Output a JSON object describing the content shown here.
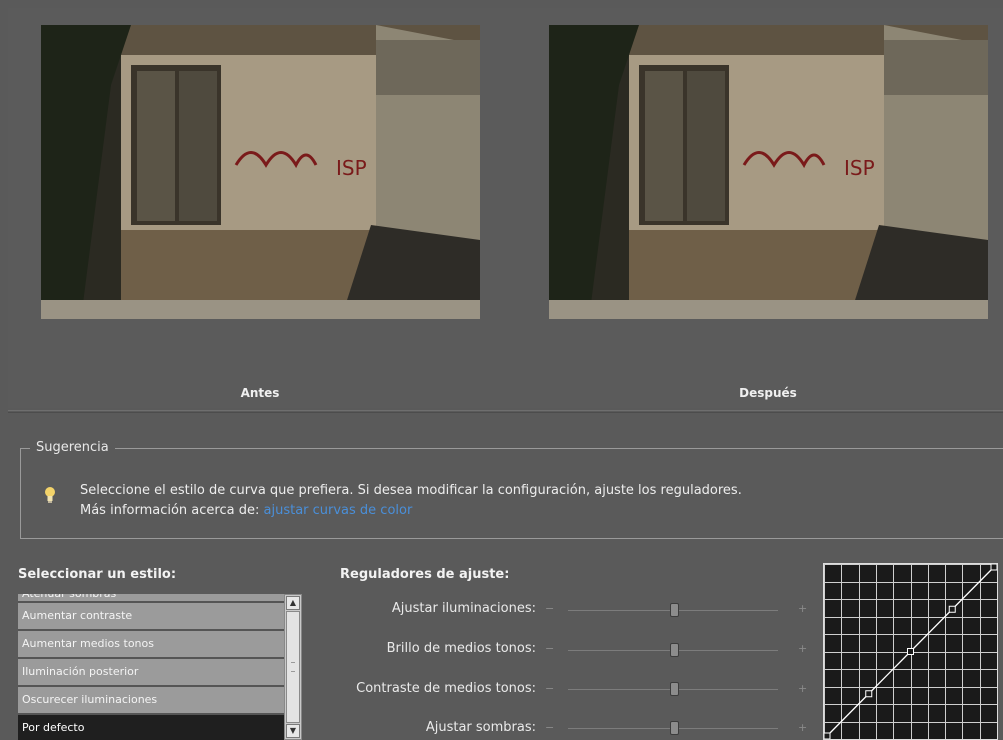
{
  "preview": {
    "before_label": "Antes",
    "after_label": "Después"
  },
  "tip": {
    "legend": "Sugerencia",
    "line1": "Seleccione el estilo de curva que prefiera. Si desea modificar la configuración, ajuste los reguladores.",
    "line2_prefix": "Más información acerca de:",
    "link": "ajustar curvas de color",
    "icon": "lightbulb-icon"
  },
  "styles": {
    "title": "Seleccionar un estilo:",
    "items": [
      {
        "label": "Atenuar sombras"
      },
      {
        "label": "Aumentar contraste"
      },
      {
        "label": "Aumentar medios tonos"
      },
      {
        "label": "Iluminación posterior"
      },
      {
        "label": "Oscurecer iluminaciones"
      },
      {
        "label": "Por defecto"
      }
    ],
    "selected": "Por defecto"
  },
  "sliders": {
    "title": "Reguladores de ajuste:",
    "items": [
      {
        "label": "Ajustar iluminaciones:",
        "minus": "−",
        "plus": "+",
        "value": 0.5
      },
      {
        "label": "Brillo de medios tonos:",
        "minus": "−",
        "plus": "+",
        "value": 0.5
      },
      {
        "label": "Contraste de medios tonos:",
        "minus": "−",
        "plus": "+",
        "value": 0.5
      },
      {
        "label": "Ajustar sombras:",
        "minus": "−",
        "plus": "+",
        "value": 0.5
      }
    ]
  },
  "curve": {
    "points": [
      [
        0,
        0
      ],
      [
        0.25,
        0.25
      ],
      [
        0.5,
        0.5
      ],
      [
        0.75,
        0.75
      ],
      [
        1,
        1
      ]
    ]
  },
  "colors": {
    "link": "#4a8fd9",
    "selected_item": "#1f1f1f",
    "list_item": "#9b9b9b"
  }
}
